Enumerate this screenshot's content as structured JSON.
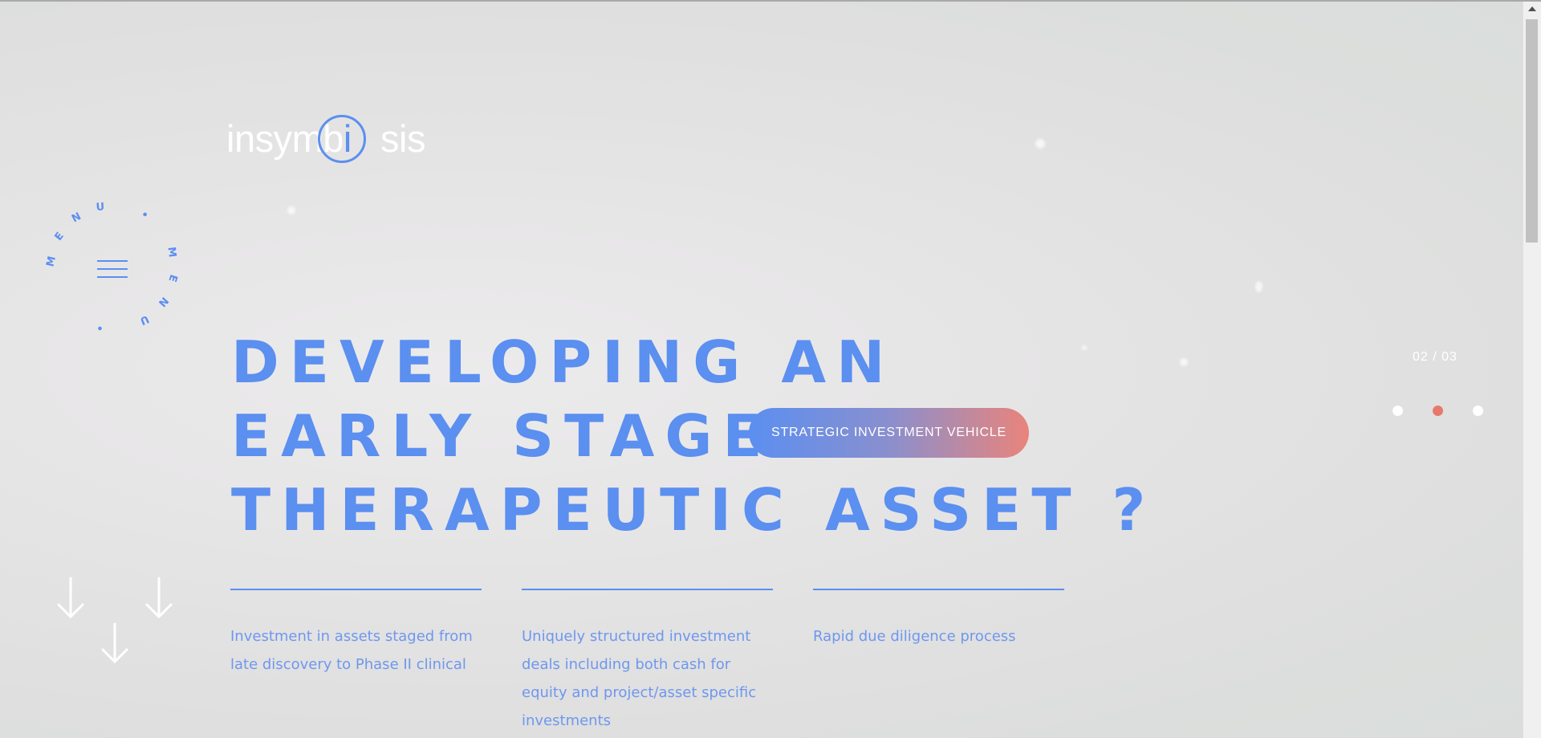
{
  "brand": {
    "logo_part1": "insymb",
    "logo_part2": "i",
    "logo_part3": "sis"
  },
  "menu": {
    "ring_text": "MENU • MENU •",
    "icon": "hamburger-icon"
  },
  "hero": {
    "line1": "DEVELOPING AN",
    "line2": "EARLY STAGE",
    "line3": "THERAPEUTIC ASSET ?",
    "pill_label": "STRATEGIC INVESTMENT VEHICLE"
  },
  "features": [
    {
      "text": "Investment in assets staged from late discovery to Phase II clinical"
    },
    {
      "text": "Uniquely structured investment deals including both cash for equity and project/asset specific investments"
    },
    {
      "text": "Rapid due diligence process"
    }
  ],
  "slider": {
    "counter": "02 / 03",
    "current": 2,
    "total": 3
  },
  "scroll_icon": "arrow-down-icon",
  "colors": {
    "accent": "#5b8ff0",
    "active_dot": "#e6796c",
    "pill_start": "#5b8ff0",
    "pill_end": "#e9847b"
  }
}
